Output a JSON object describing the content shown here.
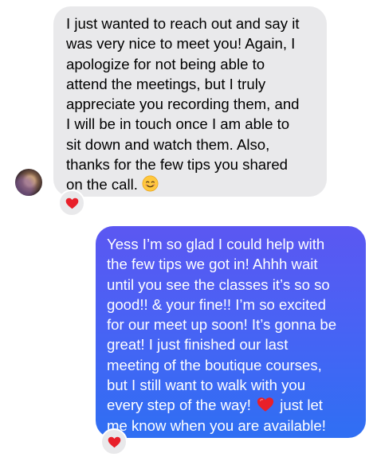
{
  "conversation": {
    "received": {
      "lines": [
        "I just wanted to reach out and say it",
        "was very nice to meet you! Again, I",
        "apologize for not being able to",
        "attend the meetings, but I truly",
        "appreciate you recording them, and",
        "I will be in touch once I am able to",
        "sit down and watch them. Also,",
        "thanks for the few tips you shared",
        "on the call."
      ],
      "emoji": "smiling-face-icon",
      "reaction": "heart-icon"
    },
    "sent": {
      "lines": [
        "Yess I’m so glad I could help with",
        "the few tips we got in! Ahhh wait",
        "until you see the classes it’s so so",
        "good!! & your fine!! I’m so excited",
        "for our meet up soon! It’s gonna be",
        "great! I just finished our last",
        "meeting of the boutique courses,",
        "but I still want to walk with you",
        "every step of the way!",
        "just let",
        "me know when you are available!"
      ],
      "inline_emoji": "red-heart-icon",
      "reaction": "heart-icon"
    }
  },
  "colors": {
    "received_bubble": "#e9e9eb",
    "sent_bubble_top": "#5b57f2",
    "sent_bubble_bottom": "#2f6ff3",
    "heart": "#e8202a",
    "smile_face": "#ffc83d"
  }
}
